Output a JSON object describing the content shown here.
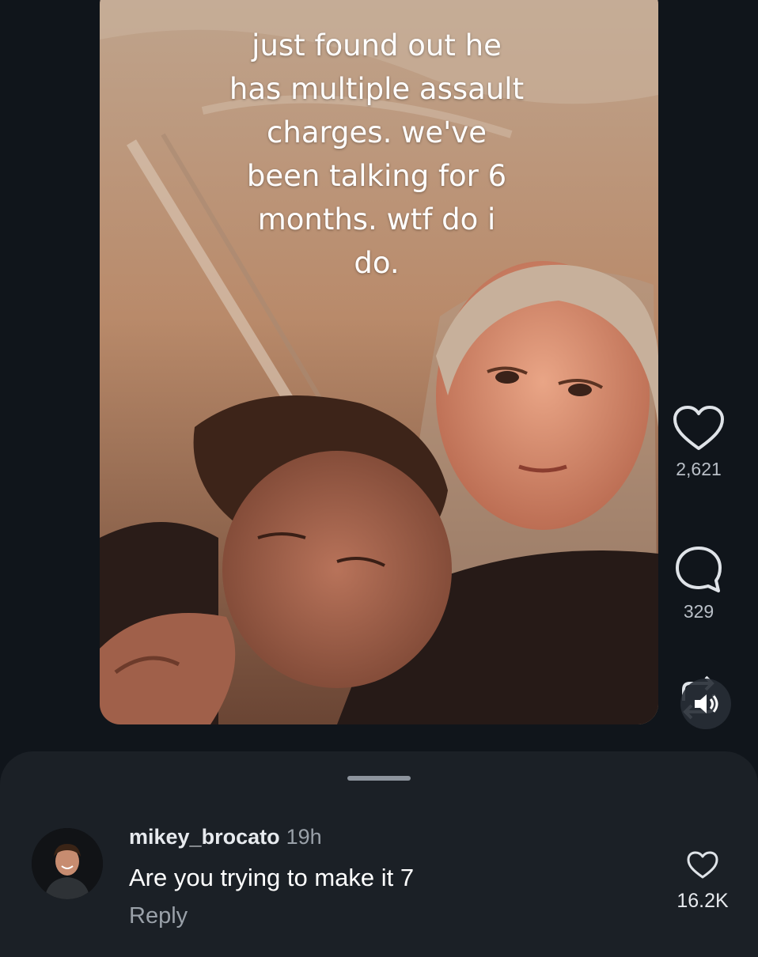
{
  "video": {
    "caption": "just found out he\nhas multiple assault\ncharges. we've\nbeen talking for 6\nmonths. wtf do i\ndo."
  },
  "actions": {
    "like": {
      "icon": "heart-outline-icon",
      "count": "2,621"
    },
    "comment": {
      "icon": "chat-bubble-icon",
      "count": "329"
    },
    "repost": {
      "icon": "repost-icon"
    },
    "mute": {
      "icon": "speaker-icon"
    }
  },
  "comment": {
    "username": "mikey_brocato",
    "time": "19h",
    "text": "Are you trying to make it 7",
    "reply_label": "Reply",
    "like_count": "16.2K",
    "like_icon": "heart-outline-icon"
  },
  "colors": {
    "background": "#10151b",
    "sheet": "#1b2026",
    "muted_text": "#9aa1a9"
  }
}
